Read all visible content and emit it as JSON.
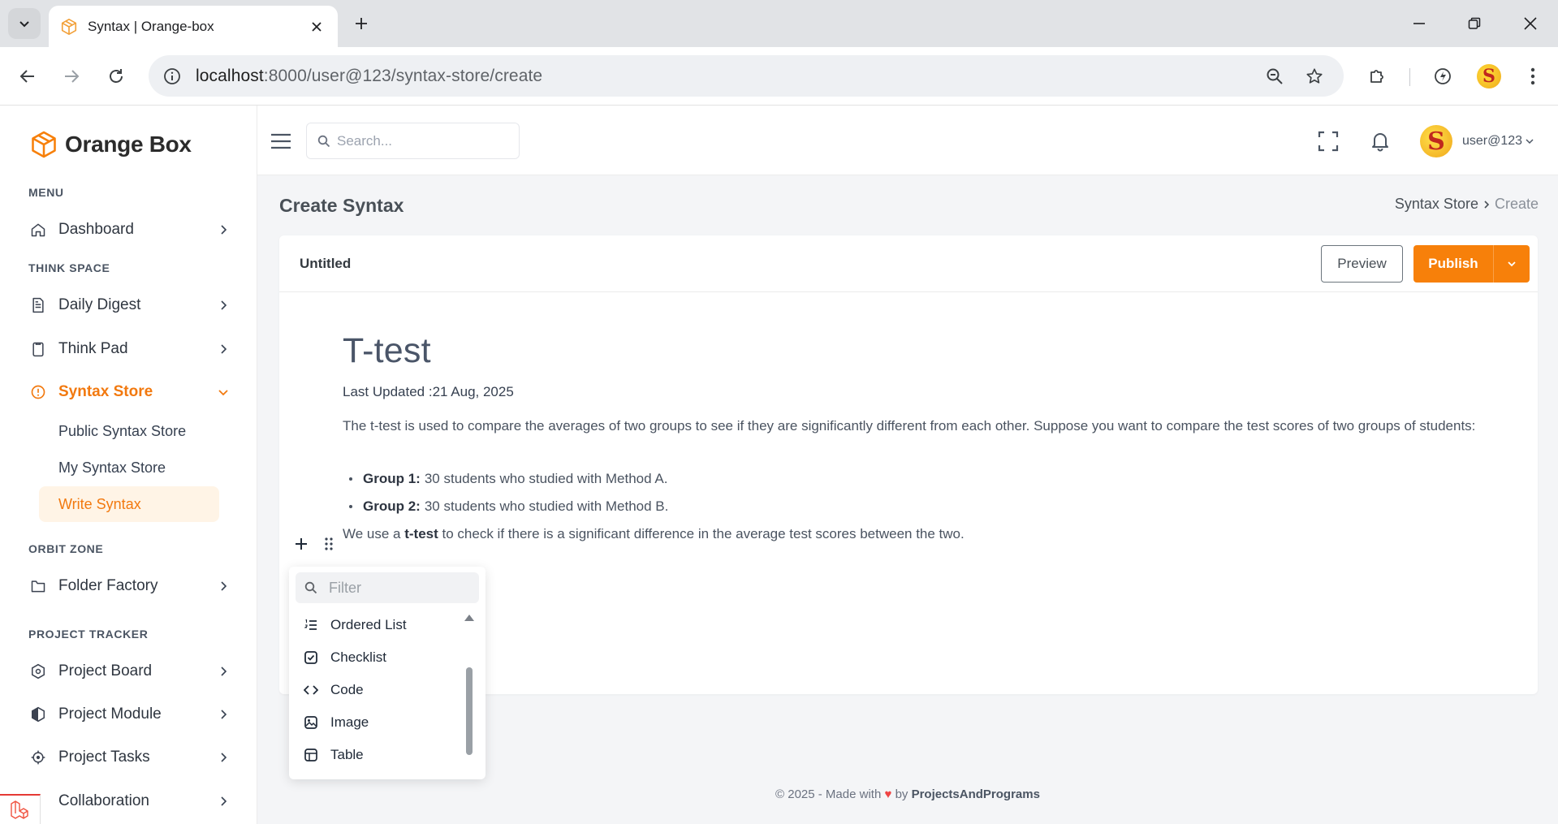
{
  "browser": {
    "tab_title": "Syntax | Orange-box",
    "url_host": "localhost",
    "url_rest": ":8000/user@123/syntax-store/create"
  },
  "brand": {
    "name": "Orange Box",
    "accent": "#f7800a"
  },
  "sidebar": {
    "sections": {
      "menu": "MENU",
      "think_space": "THINK SPACE",
      "orbit_zone": "ORBIT ZONE",
      "project_tracker": "PROJECT TRACKER"
    },
    "items": {
      "dashboard": "Dashboard",
      "daily_digest": "Daily Digest",
      "think_pad": "Think Pad",
      "syntax_store": "Syntax Store",
      "folder_factory": "Folder Factory",
      "project_board": "Project Board",
      "project_module": "Project Module",
      "project_tasks": "Project Tasks",
      "collaboration": "Collaboration"
    },
    "subitems": {
      "public": "Public Syntax Store",
      "mine": "My Syntax Store",
      "write": "Write Syntax"
    }
  },
  "header": {
    "search_placeholder": "Search...",
    "user_name": "user@123",
    "avatar_letter": "S"
  },
  "page": {
    "title": "Create Syntax",
    "breadcrumb": {
      "parent": "Syntax Store",
      "current": "Create"
    }
  },
  "card": {
    "doc_name": "Untitled",
    "preview_label": "Preview",
    "publish_label": "Publish"
  },
  "document": {
    "title": "T-test",
    "last_updated": "Last Updated :21 Aug, 2025",
    "paragraph": "The t-test is used to compare the averages of two groups to see if they are significantly different from each other. Suppose you want to compare the test scores of two groups of students:",
    "bullets": [
      {
        "label": "Group 1:",
        "text": "30 students who studied with Method A."
      },
      {
        "label": "Group 2:",
        "text": "30 students who studied with Method B."
      }
    ],
    "last_line": {
      "before": "We use a ",
      "bold": "t-test",
      "after": " to check if there is a significant difference in the average test scores between the two."
    }
  },
  "block_menu": {
    "filter_placeholder": "Filter",
    "items": [
      "Ordered List",
      "Checklist",
      "Code",
      "Image",
      "Table"
    ]
  },
  "footer": {
    "prefix": "© 2025 - Made with",
    "heart": "♥",
    "by": "by",
    "author": "ProjectsAndPrograms"
  }
}
